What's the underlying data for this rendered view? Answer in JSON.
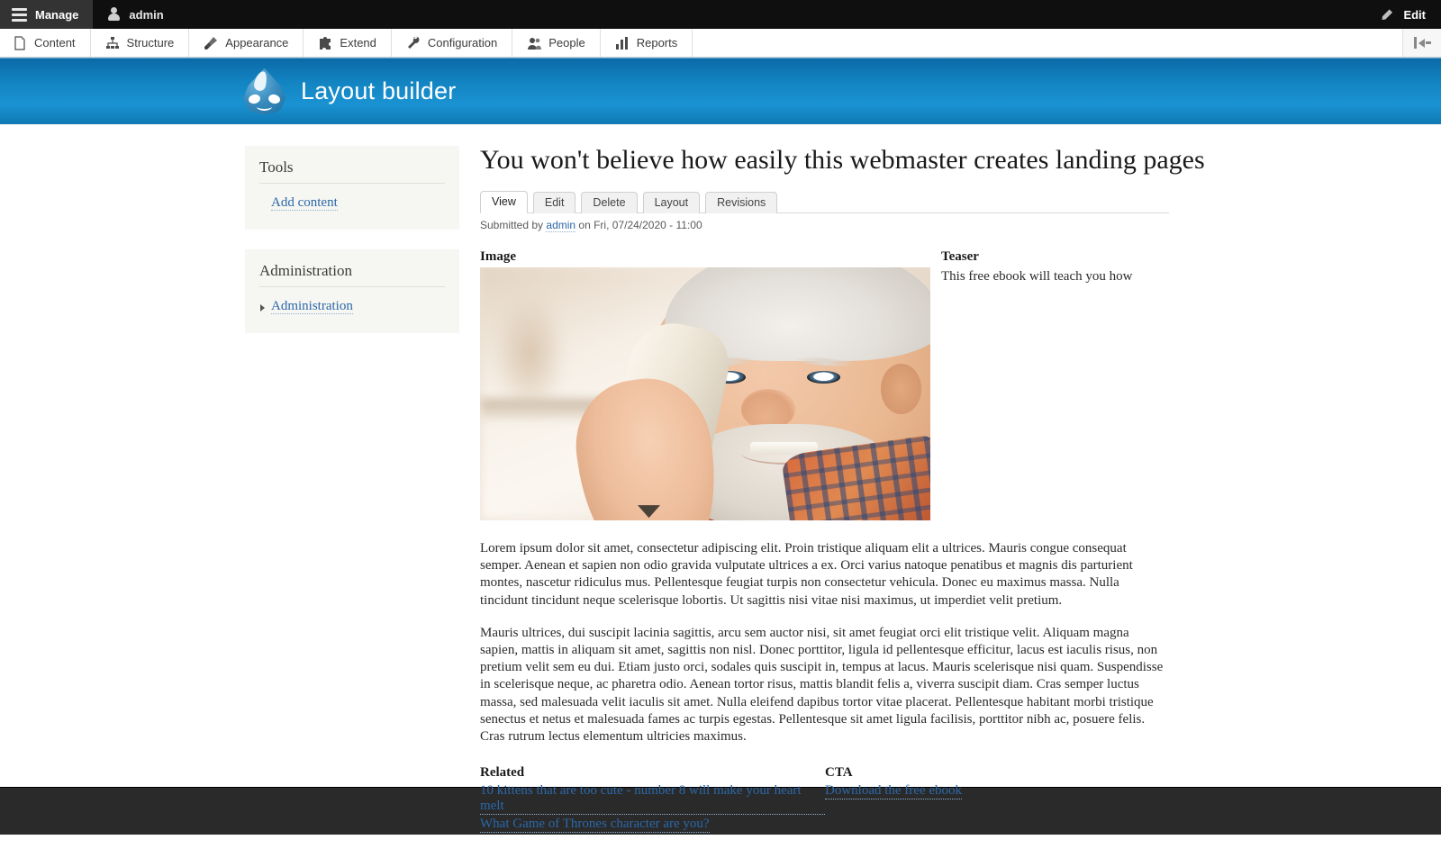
{
  "toolbar": {
    "manage_label": "Manage",
    "manage_icon": "hamburger-icon",
    "user_label": "admin",
    "user_icon": "person-icon",
    "edit_label": "Edit",
    "edit_icon": "pencil-icon",
    "collapse_icon": "collapse-sidebar-icon",
    "menu_items": [
      {
        "label": "Content",
        "icon": "document-icon"
      },
      {
        "label": "Structure",
        "icon": "sitemap-icon"
      },
      {
        "label": "Appearance",
        "icon": "paintbrush-icon"
      },
      {
        "label": "Extend",
        "icon": "puzzle-piece-icon"
      },
      {
        "label": "Configuration",
        "icon": "wrench-icon"
      },
      {
        "label": "People",
        "icon": "people-icon"
      },
      {
        "label": "Reports",
        "icon": "bar-chart-icon"
      }
    ]
  },
  "header": {
    "site_name": "Layout builder",
    "logo_icon": "drupal-droplet-icon",
    "background_color": "#1486c4"
  },
  "sidebar": {
    "blocks": [
      {
        "title": "Tools",
        "items": [
          {
            "label": "Add content",
            "marker": false
          }
        ]
      },
      {
        "title": "Administration",
        "items": [
          {
            "label": "Administration",
            "marker": true
          }
        ]
      }
    ]
  },
  "main": {
    "node_title": "You won't believe how easily this webmaster creates landing pages",
    "tabs": [
      {
        "label": "View",
        "active": true
      },
      {
        "label": "Edit",
        "active": false
      },
      {
        "label": "Delete",
        "active": false
      },
      {
        "label": "Layout",
        "active": false
      },
      {
        "label": "Revisions",
        "active": false
      }
    ],
    "submitted_prefix": "Submitted by",
    "submitted_user": "admin",
    "submitted_suffix": "on Fri, 07/24/2020 - 11:00",
    "fields": {
      "image_label": "Image",
      "image_alt": "Smiling elderly man with white hair holding a telephone handset",
      "teaser_label": "Teaser",
      "teaser_text": "This free ebook will teach you how",
      "related_label": "Related",
      "cta_label": "CTA"
    },
    "body_paragraphs": [
      "Lorem ipsum dolor sit amet, consectetur adipiscing elit. Proin tristique aliquam elit a ultrices. Mauris congue consequat semper. Aenean et sapien non odio gravida vulputate ultrices a ex. Orci varius natoque penatibus et magnis dis parturient montes, nascetur ridiculus mus. Pellentesque feugiat turpis non consectetur vehicula. Donec eu maximus massa. Nulla tincidunt tincidunt neque scelerisque lobortis. Ut sagittis nisi vitae nisi maximus, ut imperdiet velit pretium.",
      "Mauris ultrices, dui suscipit lacinia sagittis, arcu sem auctor nisi, sit amet feugiat orci elit tristique velit. Aliquam magna sapien, mattis in aliquam sit amet, sagittis non nisl. Donec porttitor, ligula id pellentesque efficitur, lacus est iaculis risus, non pretium velit sem eu dui. Etiam justo orci, sodales quis suscipit in, tempus at lacus. Mauris scelerisque nisi quam. Suspendisse in scelerisque neque, ac pharetra odio. Aenean tortor risus, mattis blandit felis a, viverra suscipit diam. Cras semper luctus massa, sed malesuada velit iaculis sit amet. Nulla eleifend dapibus tortor vitae placerat. Pellentesque habitant morbi tristique senectus et netus et malesuada fames ac turpis egestas. Pellentesque sit amet ligula facilisis, porttitor nibh ac, posuere felis. Cras rutrum lectus elementum ultricies maximus."
    ],
    "related_links": [
      "10 kittens that are too cute - number 8 will make your heart melt",
      "What Game of Thrones character are you?"
    ],
    "cta_links": [
      "Download the free ebook"
    ]
  },
  "colors": {
    "link": "#2b68a8",
    "header_blue": "#1486c4",
    "toolbar_black": "#0f0f0f",
    "footer_dark": "#2a2a2a"
  }
}
